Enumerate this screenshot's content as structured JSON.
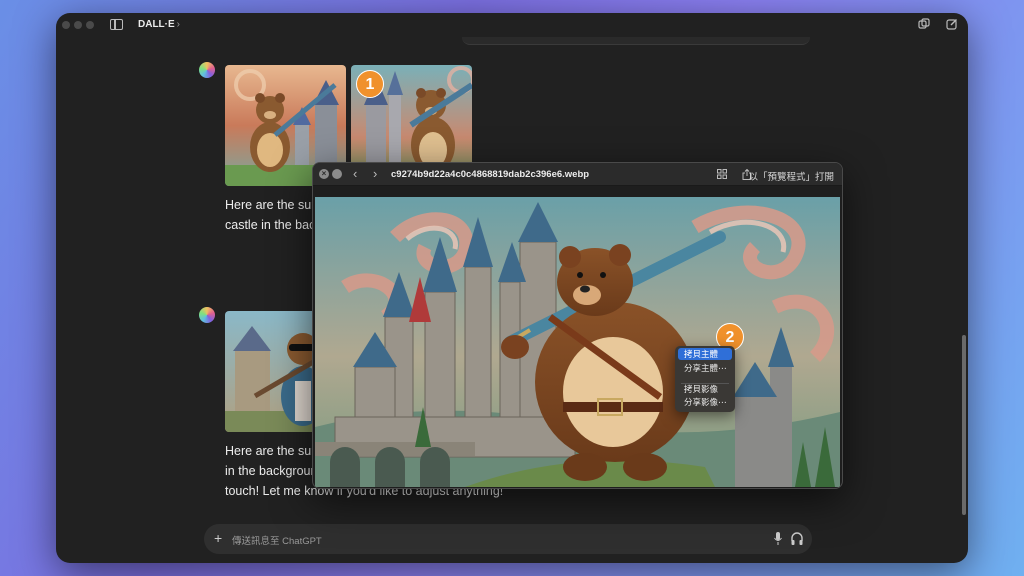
{
  "app": {
    "title": "DALL·E",
    "title_chevron": "›"
  },
  "conversation": {
    "message1_text": "Here are the sur\ncastle in the bac",
    "message2_text": "Here are the sur\nin the backgrour\ntouch! Let me know if you'd like to adjust anything!"
  },
  "badges": {
    "first": "1",
    "second": "2"
  },
  "composer": {
    "placeholder": "傳送訊息至 ChatGPT",
    "plus": "+"
  },
  "viewer": {
    "filename": "c9274b9d22a4c0c4868819dab2c396e6.webp",
    "open_with_label": "以「預覽程式」打開",
    "close_glyph": "×",
    "back_glyph": "‹",
    "forward_glyph": "›"
  },
  "context_menu": {
    "items": [
      "拷貝主體",
      "分享主體⋯",
      "拷貝影像",
      "分享影像⋯"
    ],
    "selected_index": 0
  },
  "colors": {
    "background": "#212121",
    "badge": "#f0912c",
    "menu_selection": "#2f6fd8"
  }
}
